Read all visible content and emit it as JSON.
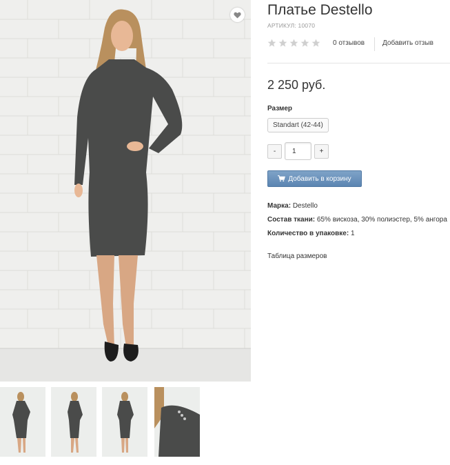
{
  "product": {
    "title": "Платье Destello",
    "sku_label": "Артикул:",
    "sku_value": "10070",
    "rating": 0,
    "reviews_count_text": "0 отзывов",
    "add_review_text": "Добавить отзыв",
    "price": "2 250 руб.",
    "option_label": "Размер",
    "size_option": "Standart (42-44)",
    "qty_minus": "-",
    "qty_value": "1",
    "qty_plus": "+",
    "add_to_cart": "Добавить в корзину",
    "specs": [
      {
        "label": "Марка:",
        "value": "Destello"
      },
      {
        "label": "Состав ткани:",
        "value": "65% вискоза, 30% полиэстер, 5% ангора"
      },
      {
        "label": "Количество в упаковке:",
        "value": "1"
      }
    ],
    "size_table_link": "Таблица размеров"
  },
  "icons": {
    "wishlist": "heart-icon",
    "stars": "star-icon",
    "cart": "cart-icon"
  },
  "colors": {
    "cart_button": "#6a92bd",
    "star_empty": "#d0d0d0",
    "dress": "#4a4b4a"
  }
}
